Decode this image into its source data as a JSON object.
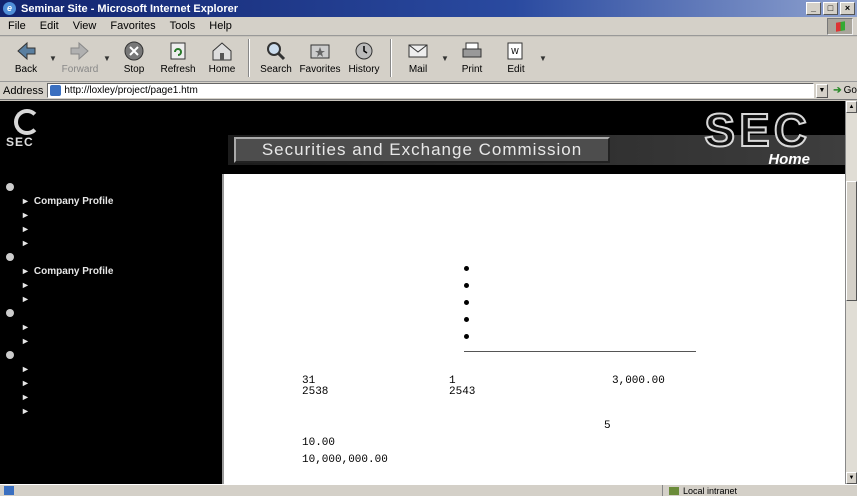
{
  "window": {
    "title": "Seminar Site - Microsoft Internet Explorer",
    "controls": [
      "_",
      "□",
      "×"
    ]
  },
  "menu": [
    "File",
    "Edit",
    "View",
    "Favorites",
    "Tools",
    "Help"
  ],
  "toolbar": {
    "back": "Back",
    "forward": "Forward",
    "stop": "Stop",
    "refresh": "Refresh",
    "home": "Home",
    "search": "Search",
    "favorites": "Favorites",
    "history": "History",
    "mail": "Mail",
    "print": "Print",
    "edit": "Edit"
  },
  "address": {
    "label": "Address",
    "url": "http://loxley/project/page1.htm",
    "go": "Go"
  },
  "banner": {
    "logo_text": "SEC",
    "title": "Securities and Exchange Commission",
    "big_logo": "SEC",
    "home": "Home"
  },
  "nav": [
    {
      "label": "",
      "children": [
        "Company Profile",
        "",
        "",
        ""
      ]
    },
    {
      "label": "",
      "children": [
        "Company Profile",
        "",
        ""
      ]
    },
    {
      "label": "",
      "children": [
        "",
        ""
      ]
    },
    {
      "label": "",
      "children": [
        "",
        "",
        "",
        ""
      ]
    }
  ],
  "content": {
    "title": "",
    "company": "",
    "projects": [
      "",
      "",
      "",
      "",
      ""
    ],
    "detail_heading": "",
    "approved_label": "",
    "approved_value": "31",
    "approved_year": "2538",
    "registered_label": "",
    "registered_value": "1",
    "registered_year": "2543",
    "reg_value_label": "",
    "reg_value": "3,000.00",
    "project_type_label": "",
    "policy_label": "",
    "term_label": "",
    "term_value": "5",
    "project_value_label": "",
    "project_value": "10.00",
    "units_label": "",
    "units_value": "10,000,000.00"
  },
  "status": {
    "zone": "Local intranet"
  }
}
